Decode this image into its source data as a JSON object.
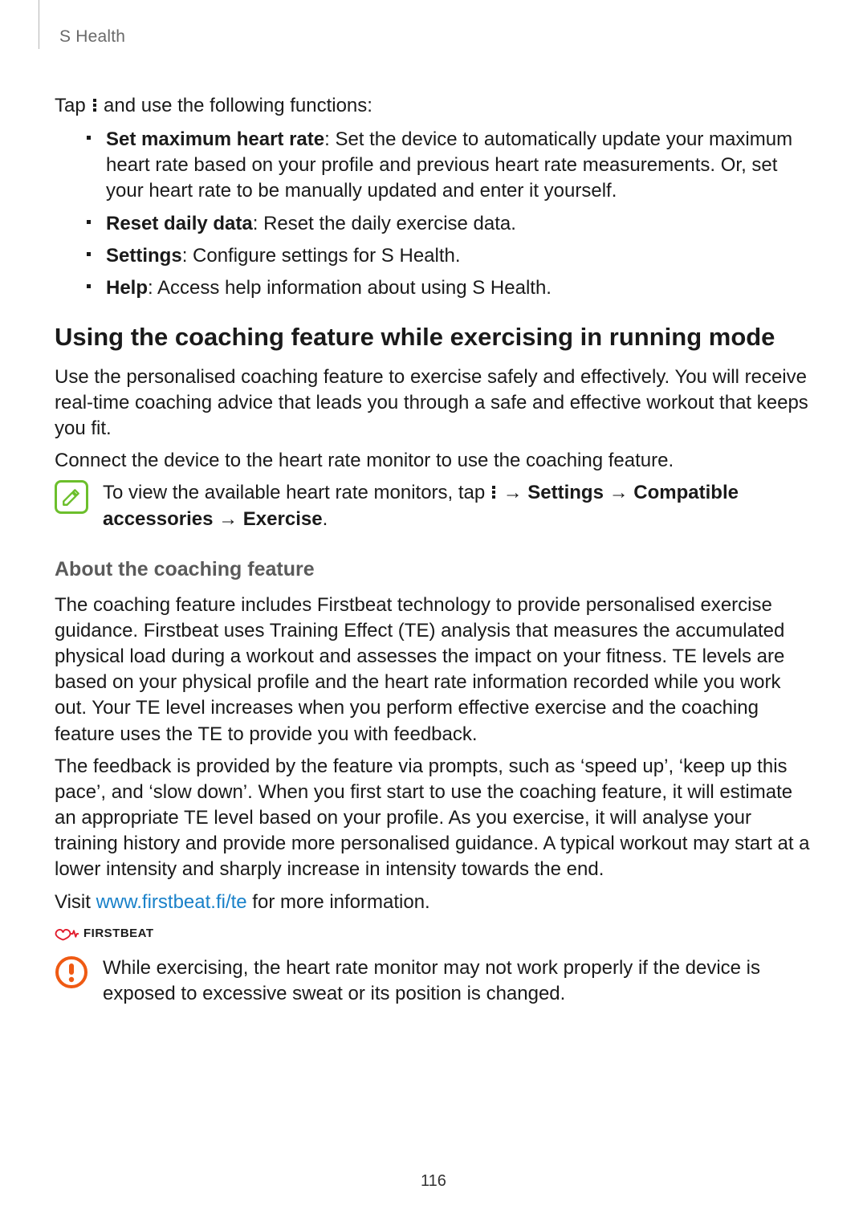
{
  "header": {
    "title": "S Health"
  },
  "intro": {
    "tap_prefix": "Tap ",
    "tap_suffix": " and use the following functions:"
  },
  "functions": [
    {
      "label": "Set maximum heart rate",
      "desc": ": Set the device to automatically update your maximum heart rate based on your profile and previous heart rate measurements. Or, set your heart rate to be manually updated and enter it yourself."
    },
    {
      "label": "Reset daily data",
      "desc": ": Reset the daily exercise data."
    },
    {
      "label": "Settings",
      "desc": ": Configure settings for S Health."
    },
    {
      "label": "Help",
      "desc": ": Access help information about using S Health."
    }
  ],
  "section": {
    "title": "Using the coaching feature while exercising in running mode",
    "p1": "Use the personalised coaching feature to exercise safely and effectively. You will receive real-time coaching advice that leads you through a safe and effective workout that keeps you fit.",
    "p2": "Connect the device to the heart rate monitor to use the coaching feature."
  },
  "note": {
    "prefix": "To view the available heart rate monitors, tap ",
    "arrow1": " → ",
    "b1": "Settings",
    "arrow2": " → ",
    "b2": "Compatible accessories",
    "arrow3": " → ",
    "b3": "Exercise",
    "suffix": "."
  },
  "about": {
    "heading": "About the coaching feature",
    "p1": "The coaching feature includes Firstbeat technology to provide personalised exercise guidance. Firstbeat uses Training Effect (TE) analysis that measures the accumulated physical load during a workout and assesses the impact on your fitness. TE levels are based on your physical profile and the heart rate information recorded while you work out. Your TE level increases when you perform effective exercise and the coaching feature uses the TE to provide you with feedback.",
    "p2": "The feedback is provided by the feature via prompts, such as ‘speed up’, ‘keep up this pace’, and ‘slow down’. When you first start to use the coaching feature, it will estimate an appropriate TE level based on your profile. As you exercise, it will analyse your training history and provide more personalised guidance. A typical workout may start at a lower intensity and sharply increase in intensity towards the end.",
    "visit_prefix": "Visit ",
    "visit_link": "www.firstbeat.fi/te",
    "visit_suffix": " for more information."
  },
  "brand": {
    "name": "FIRSTBEAT"
  },
  "warning": {
    "text": "While exercising, the heart rate monitor may not work properly if the device is exposed to excessive sweat or its position is changed."
  },
  "page_number": "116"
}
